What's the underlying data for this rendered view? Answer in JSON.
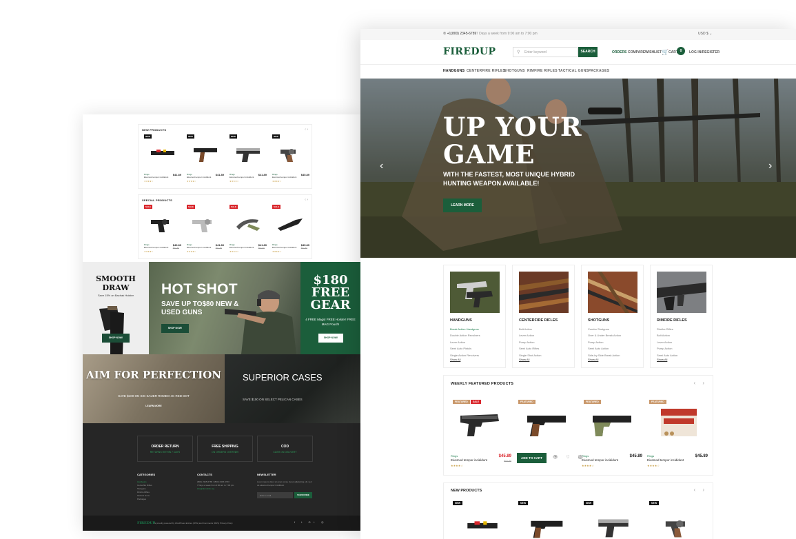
{
  "left_page": {
    "new_products": {
      "title": "NEW PRODUCTS",
      "nav": "‹ ›",
      "items": [
        {
          "badge": "NEW",
          "brand": "Rings",
          "name": "Eiusmod tempor incididunt",
          "price": "$41.89",
          "stars": "★★★★☆"
        },
        {
          "badge": "NEW",
          "brand": "Rings",
          "name": "Eiusmod tempor incididunt",
          "price": "$41.89",
          "stars": "★★★★☆"
        },
        {
          "badge": "NEW",
          "brand": "Rings",
          "name": "Eiusmod tempor incididunt",
          "price": "$41.89",
          "stars": "★★★★☆"
        },
        {
          "badge": "NEW",
          "brand": "Rings",
          "name": "Eiusmod tempor incididunt",
          "price": "$45.89",
          "stars": "★★★★☆"
        }
      ]
    },
    "special_products": {
      "title": "SPECIAL PRODUCTS",
      "nav": "‹ ›",
      "items": [
        {
          "badge": "SALE",
          "brand": "Rings",
          "name": "Eiusmod tempor incididunt",
          "price": "$43.89",
          "old": "$51.89",
          "stars": "★★★★☆"
        },
        {
          "badge": "SALE",
          "brand": "Rings",
          "name": "Eiusmod tempor incididunt",
          "price": "$41.89",
          "old": "$51.89",
          "stars": "★★★★☆"
        },
        {
          "badge": "SALE",
          "brand": "Rings",
          "name": "Eiusmod tempor incididunt",
          "price": "$41.89",
          "old": "$51.89",
          "stars": "★★★★☆"
        },
        {
          "badge": "SALE",
          "brand": "Rings",
          "name": "Eiusmod tempor incididunt",
          "price": "$45.89",
          "old": "$51.89",
          "stars": "★★★★☆"
        }
      ]
    },
    "promos": {
      "smooth": {
        "title": "SMOOTH DRAW",
        "sub": "Save 15% on Bachak Holster",
        "btn": "SHOP NOW!"
      },
      "hotshot": {
        "title": "HOT SHOT",
        "sub": "SAVE UP TO$80 NEW & USED GUNS",
        "btn": "SHOP NOW!"
      },
      "freegear": {
        "title": "$180 FREE GEAR",
        "sub": "4 FREE Mags! FREE Holster! FREE MAG Pouch!",
        "btn": "SHOP NOW!"
      },
      "aim": {
        "title": "AIM FOR PERFECTION",
        "sub": "SAVE $100 ON SIG SAUER ROMEO 4C RED DOT",
        "btn": "LEARN MORE"
      },
      "cases": {
        "title": "SUPERIOR CASES",
        "sub": "SAVE $100 ON SELECT PELICAN CASES"
      }
    },
    "services": [
      {
        "title": "ORDER RETURN",
        "sub": "RETURNS WITHIN 7 DAYS"
      },
      {
        "title": "FREE SHIPPING",
        "sub": "ON ORDERS OVER $99"
      },
      {
        "title": "COD",
        "sub": "CASH ON DELIVERY"
      }
    ],
    "footer": {
      "categories_title": "CATEGORIES",
      "categories": [
        "Handguns",
        "Centerfire Rifles",
        "Shotguns",
        "Rimfire Rifles",
        "Tactical Guns",
        "Packages"
      ],
      "contacts_title": "CONTACTS",
      "contacts": [
        "(800) 2345-6789 / (800) 2345-6790",
        "7 Days a week from 9:00 am to 7:00 pm",
        "info@demolink.org"
      ],
      "newsletter_title": "NEWSLETTER",
      "newsletter_text": "Lorem ipsum dolor sit amet conse ctetur adipisicing elit, sed do eiusmod tempor incididunt",
      "newsletter_placeholder": "Enter e-mail",
      "subscribe": "SUBSCRIBE",
      "logo": "FIREDUP",
      "copyright": "is proudly powered by WordPress Entries (RSS) and Comments (RSS) Privacy Policy",
      "social": "f t G+ ◎"
    }
  },
  "right_page": {
    "topbar": {
      "phone": "+1(800) 2345-6789",
      "hours": "7 Days a week from 9:00 am to 7:00 pm",
      "currency": "USD $"
    },
    "header": {
      "brand": "FIREDUP",
      "search_placeholder": "Enter keyword",
      "search_btn": "SEARCH",
      "orders": "ORDERS",
      "compare": "COMPARE",
      "wishlist": "WISHLIST",
      "cart": "CART",
      "cart_count": "0",
      "login": "LOG IN/REGISTER"
    },
    "nav": [
      "HANDGUNS",
      "CENTERFIRE RIFLES",
      "SHOTGUNS",
      "RIMFIRE RIFLES",
      "TACTICAL GUNS",
      "PACKAGES"
    ],
    "hero": {
      "title_line1": "UP YOUR",
      "title_line2": "GAME",
      "subtitle": "WITH THE FASTEST, MOST UNIQUE HYBRID HUNTING WEAPON AVAILABLE!",
      "cta": "LEARN MORE",
      "prev": "‹",
      "next": "›"
    },
    "categories": [
      {
        "name": "HANDGUNS",
        "items": [
          "Break Action Handguns",
          "Double Action Revolvers",
          "Lever Action",
          "Semi Auto Pistols",
          "Single Action Revolvers"
        ],
        "more": "Show All"
      },
      {
        "name": "CENTERFIRE RIFLES",
        "items": [
          "Bolt Action",
          "Lever Action",
          "Pump Action",
          "Semi Auto Rifles",
          "Single Shot Action"
        ],
        "more": "Show All"
      },
      {
        "name": "SHOTGUNS",
        "items": [
          "Combo Shotguns",
          "Over & Under Break Action",
          "Pump Action",
          "Semi Auto Action",
          "Side-by-Side Break Action"
        ],
        "more": "Show All"
      },
      {
        "name": "RIMFIRE RIFLES",
        "items": [
          "Rimfire Rifles",
          "Bolt Action",
          "Lever Action",
          "Pump Action",
          "Semi Auto Action"
        ],
        "more": "Show All"
      }
    ],
    "featured": {
      "title": "WEEKLY FEATURED PRODUCTS",
      "nav": "‹ ›",
      "items": [
        {
          "badges": [
            "FEATURED",
            "SALE"
          ],
          "brand": "Rings",
          "name": "Eiusmod tempor incididunt",
          "price": "$45.89",
          "old": "$51.89",
          "stars": "★★★★☆"
        },
        {
          "badges": [
            "FEATURED"
          ],
          "brand": "",
          "name": "",
          "price": "",
          "old": "",
          "stars": ""
        },
        {
          "badges": [
            "FEATURED"
          ],
          "brand": "Rings",
          "name": "Eiusmod tempor incididunt",
          "price": "$45.89",
          "old": "",
          "stars": "★★★★☆"
        },
        {
          "badges": [
            "FEATURED"
          ],
          "brand": "Rings",
          "name": "Eiusmod tempor incididunt",
          "price": "$45.89",
          "old": "",
          "stars": "★★★★☆"
        }
      ],
      "add_to_cart": "ADD TO CART",
      "actions": "👁 ♡ ⚖"
    },
    "new_products": {
      "title": "NEW PRODUCTS",
      "nav": "‹ ›",
      "badges": [
        "NEW",
        "NEW",
        "NEW",
        "NEW"
      ]
    }
  },
  "colors": {
    "brand_green": "#1b5e3b",
    "sale_red": "#d9262c",
    "featured_tan": "#c9986b"
  }
}
